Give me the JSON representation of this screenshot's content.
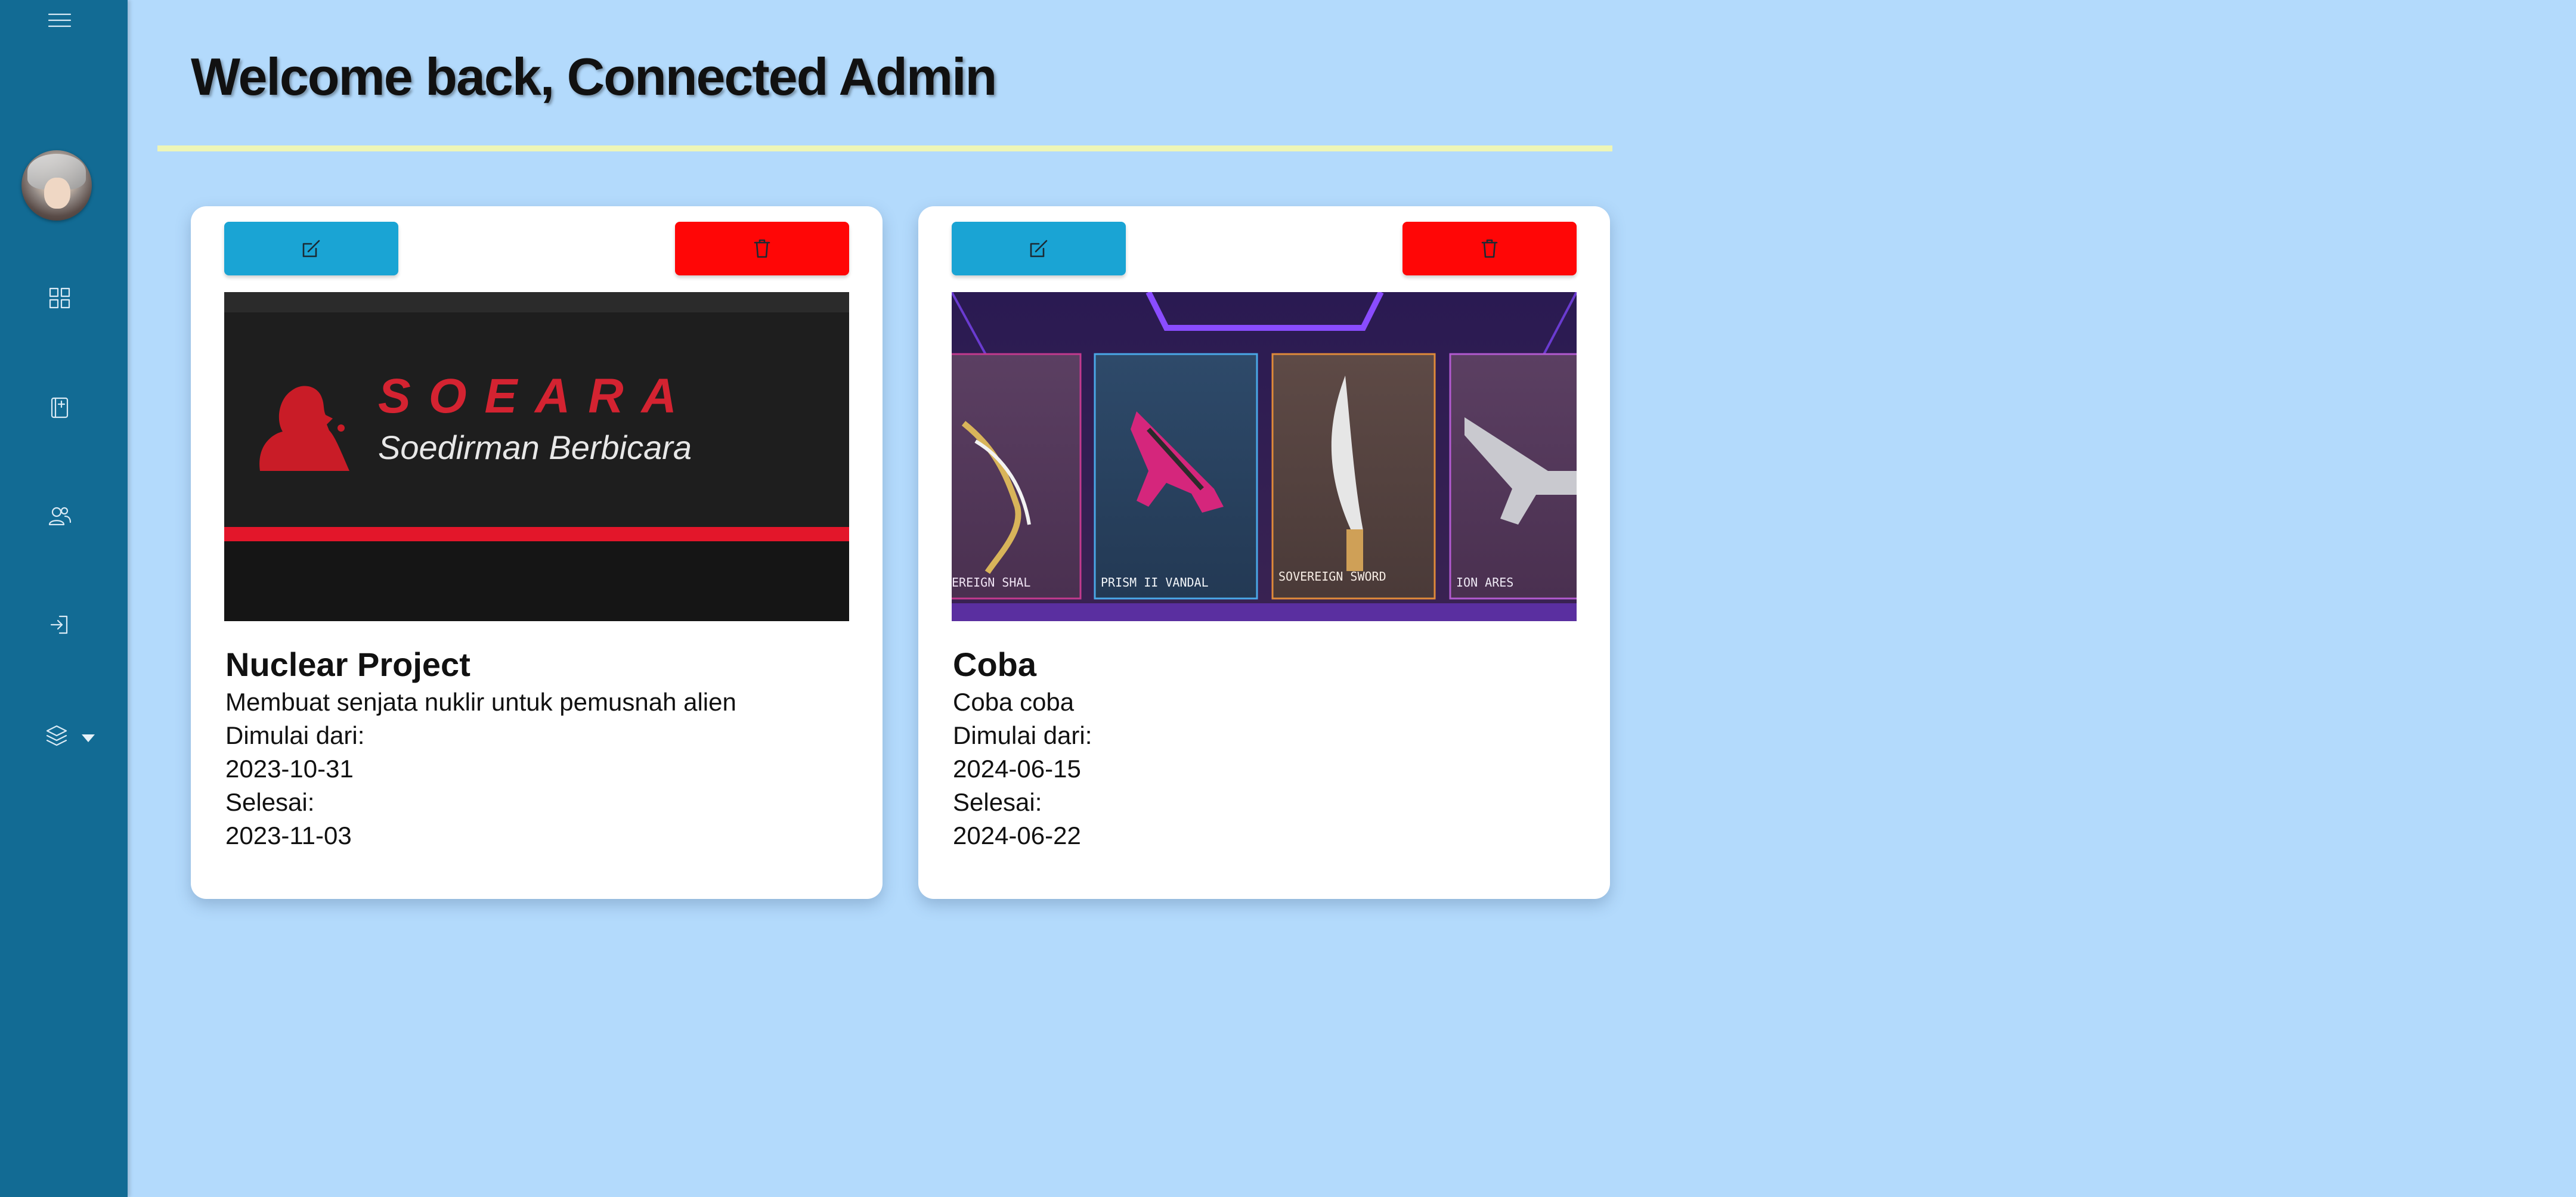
{
  "sidebar": {
    "items": [
      {
        "icon": "menu-icon"
      },
      {
        "icon": "avatar"
      },
      {
        "icon": "dashboard-grid-icon"
      },
      {
        "icon": "projects-book-icon"
      },
      {
        "icon": "users-icon"
      },
      {
        "icon": "login-icon"
      },
      {
        "icon": "layers-icon"
      }
    ],
    "colors": {
      "background": "#126b94",
      "icon": "#d9eaf5"
    }
  },
  "header": {
    "title": "Welcome back, Connected Admin"
  },
  "cards": [
    {
      "title": "Nuclear Project",
      "description": "Membuat senjata nuklir untuk pemusnah alien",
      "start_label": "Dimulai dari:",
      "start_date": "2023-10-31",
      "end_label": "Selesai:",
      "end_date": "2023-11-03",
      "image": {
        "brand": "SOEARA",
        "tagline": "Soedirman Berbicara"
      }
    },
    {
      "title": "Coba",
      "description": "Coba coba",
      "start_label": "Dimulai dari:",
      "start_date": "2024-06-15",
      "end_label": "Selesai:",
      "end_date": "2024-06-22",
      "image": {
        "items": [
          "EREIGN SHAL",
          "PRISM II VANDAL",
          "SOVEREIGN SWORD",
          "ION ARES"
        ]
      }
    }
  ],
  "colors": {
    "page_bg": "#b3dafc",
    "edit_button": "#1aa4d4",
    "delete_button": "#ff0606",
    "accent_rule": "#eef6b7"
  }
}
